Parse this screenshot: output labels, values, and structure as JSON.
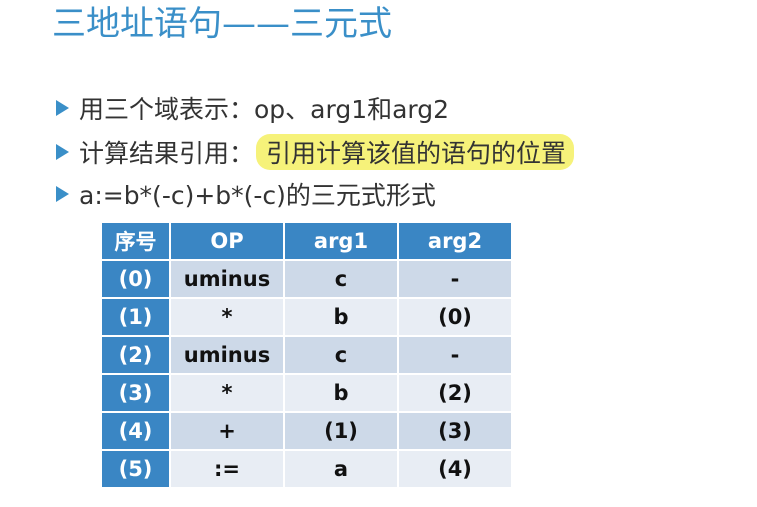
{
  "slide": {
    "title": "三地址语句——三元式",
    "bullets": [
      {
        "text": "用三个域表示：op、arg1和arg2",
        "highlight": ""
      },
      {
        "text": "计算结果引用：",
        "highlight": "引用计算该值的语句的位置"
      },
      {
        "text": "a:=b*(-c)+b*(-c)的三元式形式",
        "highlight": ""
      }
    ]
  },
  "table": {
    "headers": [
      "序号",
      "OP",
      "arg1",
      "arg2"
    ],
    "rows": [
      [
        "(0)",
        "uminus",
        "c",
        "-"
      ],
      [
        "(1)",
        "*",
        "b",
        "(0)"
      ],
      [
        "(2)",
        "uminus",
        "c",
        "-"
      ],
      [
        "(3)",
        "*",
        "b",
        "(2)"
      ],
      [
        "(4)",
        "+",
        "(1)",
        "(3)"
      ],
      [
        "(5)",
        ":=",
        "a",
        "(4)"
      ]
    ]
  },
  "colors": {
    "title": "#3a8fc8",
    "header_bg": "#3a86c4",
    "row_dark": "#cdd9e8",
    "row_light": "#e8edf4",
    "highlight": "#f6f27a"
  }
}
